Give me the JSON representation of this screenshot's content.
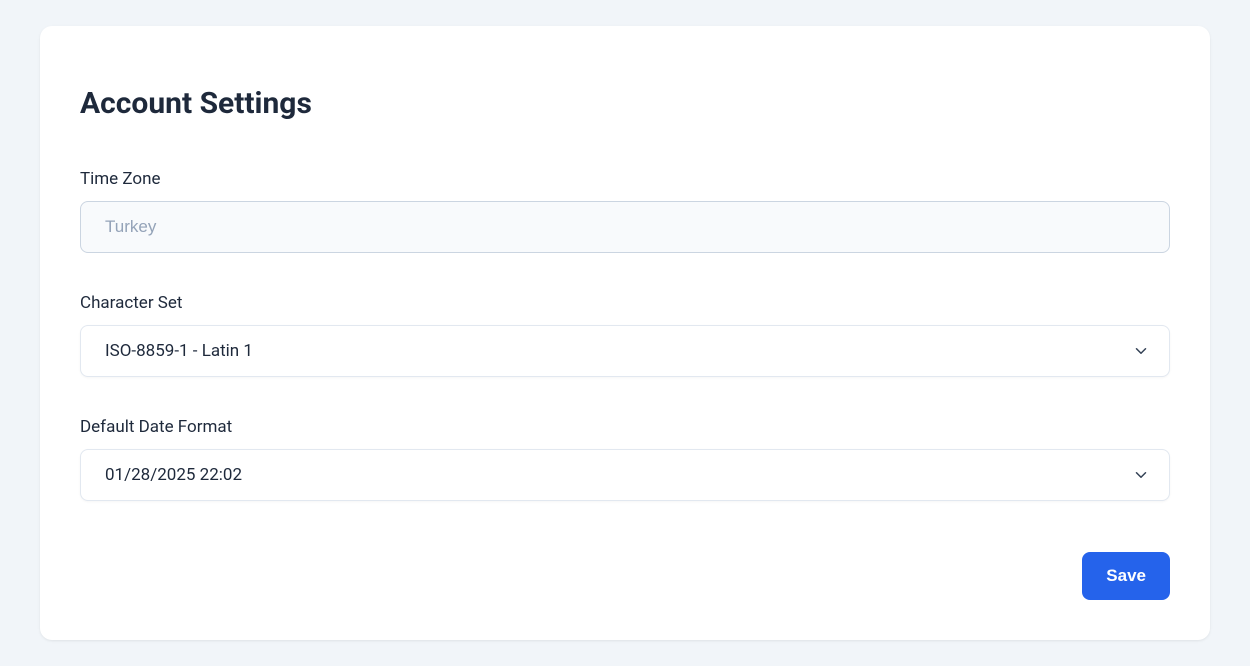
{
  "page": {
    "title": "Account Settings"
  },
  "form": {
    "timezone": {
      "label": "Time Zone",
      "placeholder": "Turkey",
      "value": ""
    },
    "charset": {
      "label": "Character Set",
      "value": "ISO-8859-1 - Latin 1"
    },
    "dateformat": {
      "label": "Default Date Format",
      "value": "01/28/2025 22:02"
    }
  },
  "actions": {
    "save": "Save"
  }
}
